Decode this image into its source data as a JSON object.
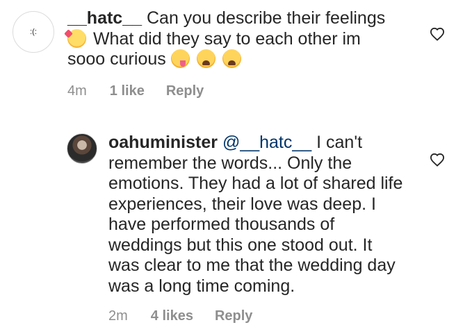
{
  "comments": [
    {
      "avatar_text": ":(:",
      "username": "__hatc__",
      "text_before_emoji": "Can you describe their feelings",
      "text_after_emoji": "What did they say to each other im",
      "text_line3": "sooo curious",
      "time": "4m",
      "likes": "1 like",
      "reply": "Reply"
    },
    {
      "username": "oahuminister",
      "mention": "@__hatc__",
      "text": "I can't remember the words... Only the emotions. They had a lot of shared life experiences, their love was deep. I have performed thousands of weddings but this one stood out. It was clear to me that the wedding day was a long time coming.",
      "time": "2m",
      "likes": "4 likes",
      "reply": "Reply"
    }
  ],
  "icons": {
    "heart_color": "#262626"
  }
}
